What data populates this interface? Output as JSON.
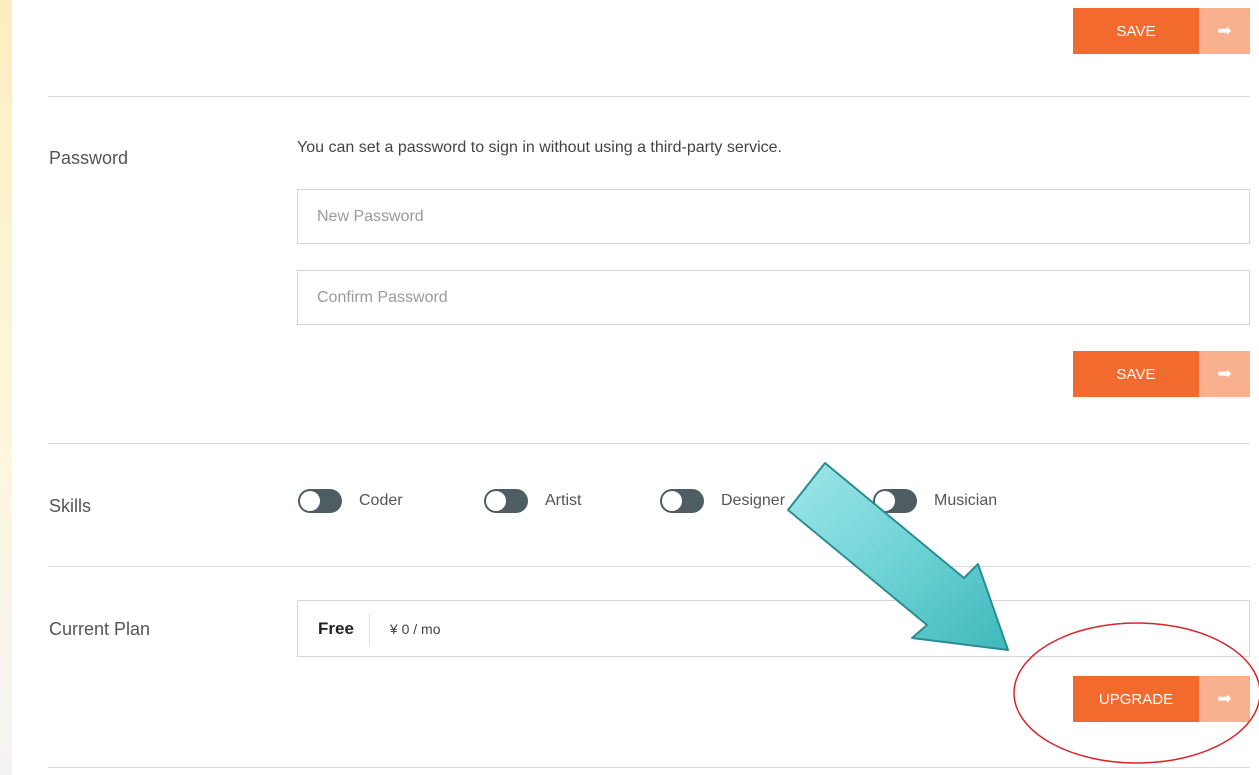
{
  "password": {
    "section_label": "Password",
    "help_text": "You can set a password to sign in without using a third-party service.",
    "new_password_placeholder": "New Password",
    "confirm_password_placeholder": "Confirm Password"
  },
  "buttons": {
    "save_top": "SAVE",
    "save_password": "SAVE",
    "upgrade": "UPGRADE"
  },
  "skills": {
    "section_label": "Skills",
    "items": [
      {
        "label": "Coder"
      },
      {
        "label": "Artist"
      },
      {
        "label": "Designer"
      },
      {
        "label": "Musician"
      }
    ]
  },
  "plan": {
    "section_label": "Current Plan",
    "name": "Free",
    "price": "¥ 0 / mo"
  },
  "colors": {
    "accent": "#f26a2e",
    "accent_light": "#f9b08f",
    "annotation_arrow": "#4fc6c9",
    "annotation_circle": "#d9242b"
  },
  "icons": {
    "button_arrow": "arrow-right-icon"
  }
}
